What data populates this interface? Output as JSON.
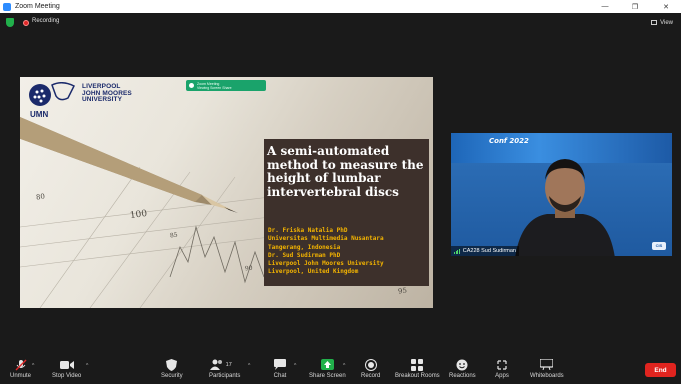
{
  "window": {
    "title": "Zoom Meeting",
    "minimize_glyph": "—",
    "maximize_glyph": "❐",
    "close_glyph": "✕"
  },
  "topbar": {
    "recording_label": "Recording",
    "view_label": "View"
  },
  "presentation": {
    "logo_lines": [
      "LIVERPOOL",
      "JOHN MOORES",
      "UNIVERSITY"
    ],
    "umn_label": "UMN",
    "meeting_chip": [
      "Zoom Meeting",
      "Viewing Screen Share"
    ],
    "chart_numbers": [
      "100",
      "80",
      "85",
      "90",
      "95"
    ],
    "title": "A semi-automated method to measure the height of lumbar intervertebral discs",
    "authors": [
      "Dr. Friska Natalia PhD",
      "Universitas Multimedia Nusantara",
      "Tangerang, Indonesia",
      "Dr. Sud Sudirman PhD",
      "Liverpool John Moores University",
      "Liverpool, United Kingdom"
    ]
  },
  "video": {
    "participant_name": "CA228 Sud Sudirman",
    "conf_year": "2022",
    "conf_prefix": "Conf",
    "audio_color": "#4fd36b"
  },
  "toolbar": {
    "items": [
      {
        "label": "Unmute",
        "icon": "microphone-muted-icon"
      },
      {
        "label": "Stop Video",
        "icon": "video-camera-icon"
      },
      {
        "label": "Security",
        "icon": "shield-icon"
      },
      {
        "label": "Participants",
        "icon": "participants-icon",
        "count": "17"
      },
      {
        "label": "Chat",
        "icon": "chat-bubble-icon"
      },
      {
        "label": "Share Screen",
        "icon": "share-screen-icon"
      },
      {
        "label": "Record",
        "icon": "record-icon"
      },
      {
        "label": "Breakout Rooms",
        "icon": "breakout-rooms-icon"
      },
      {
        "label": "Reactions",
        "icon": "reactions-icon"
      },
      {
        "label": "Apps",
        "icon": "apps-icon"
      },
      {
        "label": "Whiteboards",
        "icon": "whiteboard-icon"
      }
    ],
    "end_label": "End"
  },
  "colors": {
    "share_green": "#21b04b",
    "end_red": "#e0241f",
    "title_box": "#3d302b",
    "author_gold": "#f4b400"
  }
}
